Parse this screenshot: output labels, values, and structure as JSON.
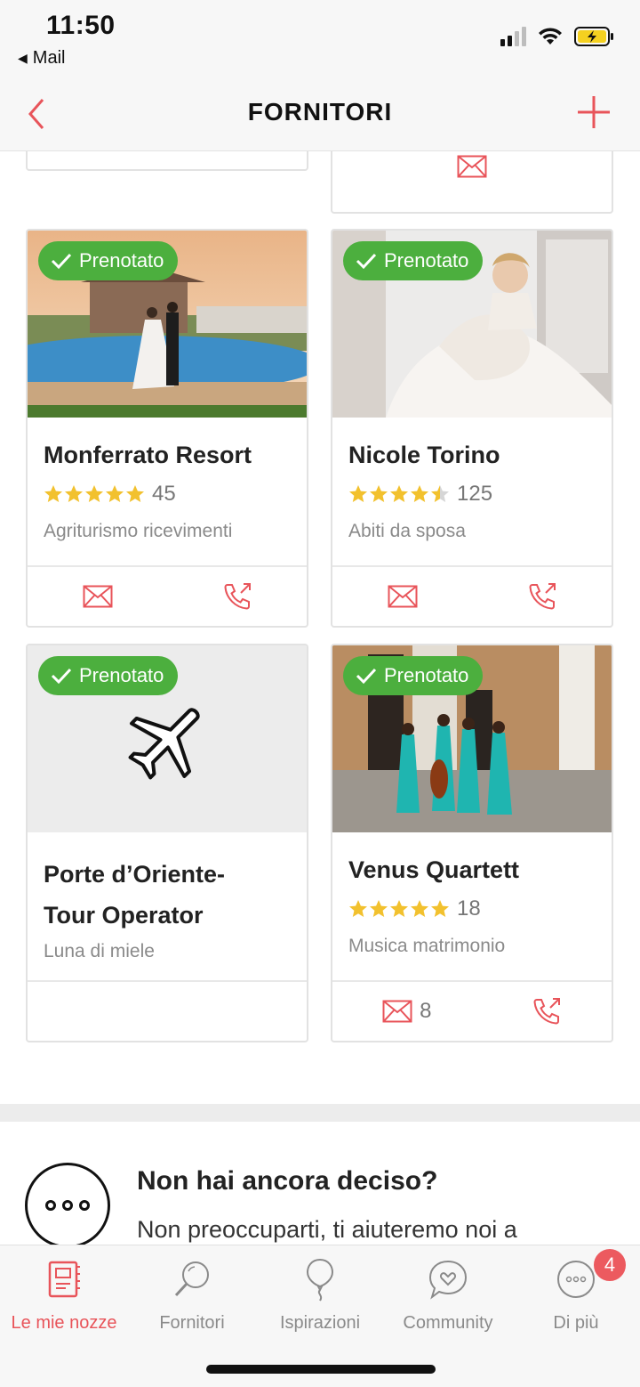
{
  "status_bar": {
    "time": "11:50",
    "back_app": "Mail"
  },
  "navbar": {
    "title": "FORNITORI"
  },
  "colors": {
    "accent": "#e8545a",
    "booked_green": "#4caf3e",
    "star": "#f2c12e"
  },
  "vendors": [
    {
      "badge": "Prenotato",
      "name": "Monferrato Resort",
      "rating": 5,
      "reviews": "45",
      "category": "Agriturismo ricevimenti",
      "image": "resort-couple-pool-photo",
      "actions": [
        "mail",
        "call"
      ]
    },
    {
      "badge": "Prenotato",
      "name": "Nicole Torino",
      "rating": 4.5,
      "reviews": "125",
      "category": "Abiti da sposa",
      "image": "bridal-gown-photo",
      "actions": [
        "mail",
        "call"
      ]
    },
    {
      "badge": "Prenotato",
      "name": "Porte d’Oriente-Tour Operator",
      "name_line1": "Porte d’Oriente-",
      "name_line2": "Tour Operator",
      "category": "Luna di miele",
      "image": "airplane-icon",
      "actions": []
    },
    {
      "badge": "Prenotato",
      "name": "Venus Quartett",
      "rating": 5,
      "reviews": "18",
      "category": "Musica matrimonio",
      "image": "string-quartet-photo",
      "mail_count": "8",
      "actions": [
        "mail",
        "call"
      ]
    }
  ],
  "help": {
    "title": "Non hai ancora deciso?",
    "text": "Non preoccuparti, ti aiuteremo noi a"
  },
  "tabs": [
    {
      "label": "Le mie nozze",
      "icon": "planner-book-icon",
      "active": true
    },
    {
      "label": "Fornitori",
      "icon": "magnifier-icon"
    },
    {
      "label": "Ispirazioni",
      "icon": "balloon-icon"
    },
    {
      "label": "Community",
      "icon": "chat-heart-icon"
    },
    {
      "label": "Di più",
      "icon": "more-icon",
      "badge": "4"
    }
  ]
}
